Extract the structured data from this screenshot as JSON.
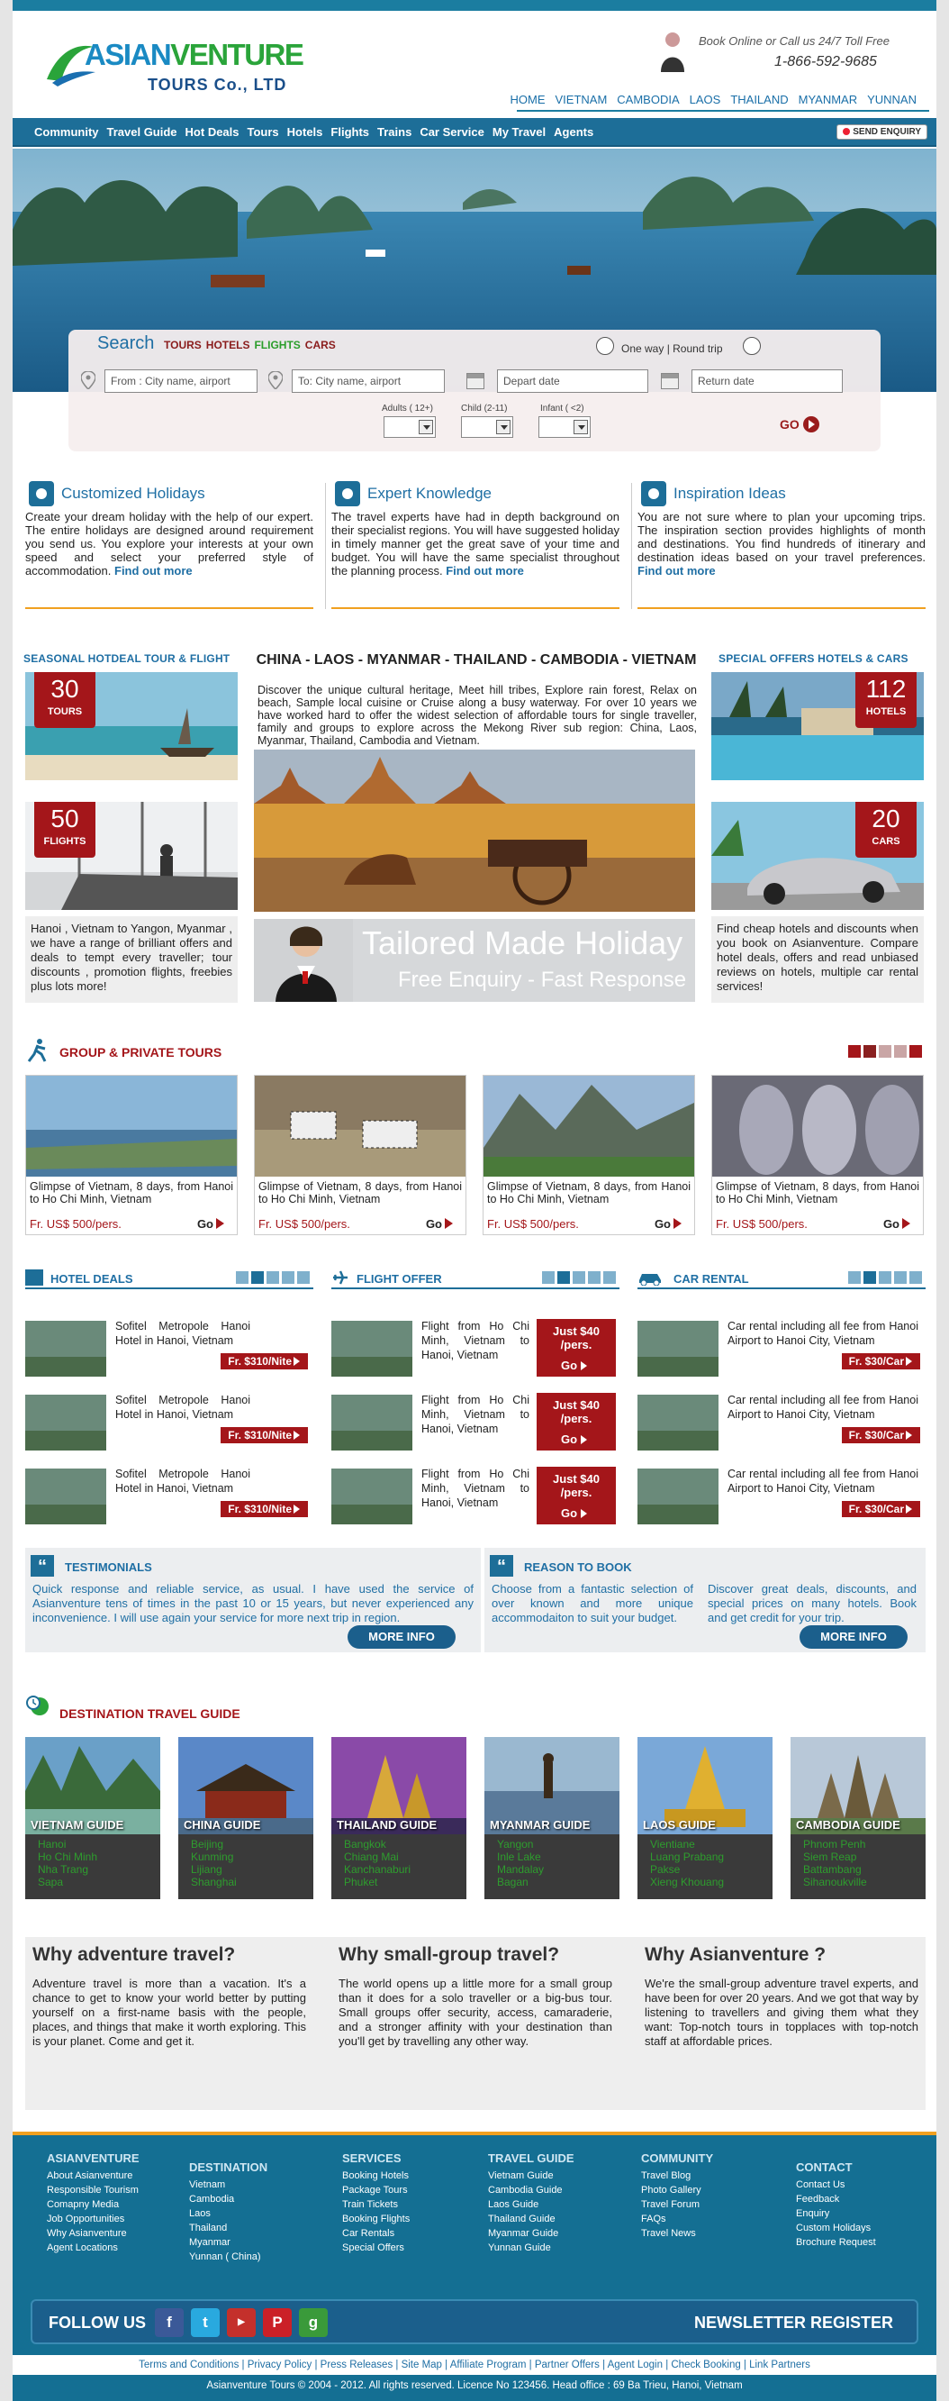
{
  "brand": {
    "logo_a": "ASIAN",
    "logo_b": "VENTURE",
    "logo_sub": "TOURS Co., LTD"
  },
  "contact": {
    "line1": "Book Online or Call us 24/7 Toll Free",
    "phone": "1-866-592-9685"
  },
  "top_nav": [
    "HOME",
    "VIETNAM",
    "CAMBODIA",
    "LAOS",
    "THAILAND",
    "MYANMAR",
    "YUNNAN"
  ],
  "main_nav": [
    "Community",
    "Travel Guide",
    "Hot Deals",
    "Tours",
    "Hotels",
    "Flights",
    "Trains",
    "Car Service",
    "My Travel",
    "Agents"
  ],
  "send_enquiry": "SEND ENQUIRY",
  "search": {
    "label": "Search",
    "tabs": [
      "TOURS",
      "HOTELS",
      "FLIGHTS",
      "CARS"
    ],
    "trip_label": "One way  |  Round trip",
    "from_placeholder": "From : City name, airport",
    "to_placeholder": "To: City name, airport",
    "depart_placeholder": "Depart date",
    "return_placeholder": "Return  date",
    "adults_label": "Adults ( 12+)",
    "child_label": "Child (2-11)",
    "infant_label": "Infant ( <2)",
    "go": "GO"
  },
  "features": [
    {
      "title": "Customized Holidays",
      "text": "Create your dream holiday with the help of our expert. The entire holidays are designed around requirement you send us.  You  explore your interests at your own speed and select your preferred style of accommodation. ",
      "more": "Find out more"
    },
    {
      "title": "Expert Knowledge",
      "text": "The travel experts have had in  depth background on their specialist regions. You will have suggested holiday in timely manner get the great save of your time and budget. You will have the same  specialist throughout the planning process. ",
      "more": "Find out more"
    },
    {
      "title": "Inspiration Ideas",
      "text": "You are not sure where to plan your upcoming trips. The inspiration section provides highlights of month and destinations. You find hundreds of itinerary and destination ideas based on your travel preferences. ",
      "more": "Find out more"
    }
  ],
  "left_promos": {
    "heading": "SEASONAL  HOTDEAL TOUR  &  FLIGHT",
    "tours_num": "30",
    "tours_label": "TOURS",
    "flights_num": "50",
    "flights_label": "FLIGHTS",
    "text": "Hanoi , Vietnam to Yangon, Myanmar , we have a range of brilliant offers and deals to tempt every traveller; tour discounts , promotion flights, freebies plus lots more!"
  },
  "center": {
    "title": "CHINA - LAOS - MYANMAR  - THAILAND - CAMBODIA - VIETNAM",
    "text": "Discover the unique cultural heritage, Meet hill tribes, Explore rain forest, Relax on beach, Sample local cuisine or Cruise along a busy waterway. For over 10 years we have worked hard to offer the widest selection of affordable tours for single traveller, family and groups to explore across the Mekong River sub region: China, Laos, Myanmar, Thailand, Cambodia and Vietnam.",
    "tailor_title": "Tailored Made Holiday",
    "tailor_sub": "Free Enquiry - Fast Response"
  },
  "right_promos": {
    "heading": "SPECIAL  OFFERS  HOTELS  &  CARS",
    "hotels_num": "112",
    "hotels_label": "HOTELS",
    "cars_num": "20",
    "cars_label": "CARS",
    "text": "Find cheap hotels and discounts when you book on Asianventure. Compare hotel deals, offers and read unbiased reviews on hotels, multiple car rental services!"
  },
  "group_tours": {
    "heading": "GROUP & PRIVATE TOURS",
    "items": [
      {
        "caption": "Glimpse of Vietnam, 8 days, from Hanoi to Ho Chi Minh, Vietnam",
        "price": "Fr. US$ 500/pers.",
        "go": "Go"
      },
      {
        "caption": "Glimpse of Vietnam, 8 days, from Hanoi to Ho Chi Minh, Vietnam",
        "price": "Fr. US$ 500/pers.",
        "go": "Go"
      },
      {
        "caption": "Glimpse of Vietnam, 8 days, from Hanoi to Ho Chi Minh, Vietnam",
        "price": "Fr. US$ 500/pers.",
        "go": "Go"
      },
      {
        "caption": "Glimpse of Vietnam, 8 days, from Hanoi to Ho Chi Minh, Vietnam",
        "price": "Fr. US$ 500/pers.",
        "go": "Go"
      }
    ]
  },
  "hotel_deals": {
    "heading": "HOTEL DEALS",
    "items": [
      {
        "text": "Sofitel  Metropole  Hanoi  Hotel in Hanoi, Vietnam",
        "price": "Fr. $310/Nite"
      },
      {
        "text": "Sofitel  Metropole  Hanoi  Hotel in Hanoi, Vietnam",
        "price": "Fr. $310/Nite"
      },
      {
        "text": "Sofitel  Metropole  Hanoi  Hotel in Hanoi, Vietnam",
        "price": "Fr. $310/Nite"
      }
    ]
  },
  "flight_offer": {
    "heading": "FLIGHT OFFER",
    "items": [
      {
        "text": "Flight from Ho Chi Minh,  Vietnam  to Hanoi, Vietnam",
        "price": "Just $40 /pers.",
        "go": "Go"
      },
      {
        "text": "Flight from Ho Chi Minh,  Vietnam  to Hanoi, Vietnam",
        "price": "Just $40 /pers.",
        "go": "Go"
      },
      {
        "text": "Flight from Ho Chi Minh,  Vietnam  to Hanoi, Vietnam",
        "price": "Just $40 /pers.",
        "go": "Go"
      }
    ]
  },
  "car_rental": {
    "heading": "CAR RENTAL",
    "items": [
      {
        "text": "Car rental including all fee from Hanoi Airport to Hanoi City, Vietnam",
        "price": "Fr. $30/Car"
      },
      {
        "text": "Car rental including all fee from Hanoi Airport to Hanoi City, Vietnam",
        "price": "Fr. $30/Car"
      },
      {
        "text": "Car rental including all fee from Hanoi Airport to Hanoi City, Vietnam",
        "price": "Fr. $30/Car"
      }
    ]
  },
  "testimonials": {
    "heading": "TESTIMONIALS",
    "text": "Quick response and reliable service, as usual. I have used the service of Asianventure tens of times in the past 10 or 15 years, but never experienced any inconvenience.  I will use again your service for more next trip in region.",
    "button": "MORE INFO"
  },
  "reason": {
    "heading": "REASON TO BOOK",
    "text1": "Choose from a fantastic selection of over  known  and  more  unique accommodaiton  to suit your budget.",
    "text2": "Discover great deals, discounts, and special prices on many hotels.  Book and get credit for your trip.",
    "button": "MORE INFO"
  },
  "guides": {
    "heading": "DESTINATION TRAVEL GUIDE",
    "items": [
      {
        "name": "VIETNAM GUIDE",
        "cities": [
          "Hanoi",
          "Ho Chi Minh",
          "Nha Trang",
          "Sapa"
        ]
      },
      {
        "name": "CHINA GUIDE",
        "cities": [
          "Beijing",
          "Kunming",
          "Lijiang",
          "Shanghai"
        ]
      },
      {
        "name": "THAILAND GUIDE",
        "cities": [
          "Bangkok",
          "Chiang Mai",
          "Kanchanaburi",
          "Phuket"
        ]
      },
      {
        "name": "MYANMAR GUIDE",
        "cities": [
          "Yangon",
          "Inle Lake",
          "Mandalay",
          "Bagan"
        ]
      },
      {
        "name": "LAOS GUIDE",
        "cities": [
          "Vientiane",
          "Luang Prabang",
          "Pakse",
          "Xieng Khouang"
        ]
      },
      {
        "name": "CAMBODIA GUIDE",
        "cities": [
          "Phnom Penh",
          "Siem Reap",
          "Battambang",
          "Sihanoukville"
        ]
      }
    ]
  },
  "why": [
    {
      "title": "Why adventure travel?",
      "text": "Adventure travel is more than a vacation. It's a chance to get to know your world better by putting yourself on a first-name basis with the people, places, and things that make it worth exploring. This is your planet. Come and get it."
    },
    {
      "title": "Why small-group travel?",
      "text": "The world opens up a little more for a small group than it does for a solo traveller or a big-bus tour. Small groups offer security, access, camaraderie, and a stronger affinity with your destination than you'll get by travelling any other way."
    },
    {
      "title": "Why Asianventure ?",
      "text": "We're the small-group adventure travel experts, and have been for over 20 years. And we got that way by listening to travellers and giving them what they want: Top-notch tours in topplaces with top-notch staff at affordable prices."
    }
  ],
  "footer": {
    "cols": [
      {
        "title": "ASIANVENTURE",
        "links": [
          "About Asianventure",
          "Responsible Tourism",
          "Comapny Media",
          "Job Opportunities",
          "Why Asianventure",
          "Agent Locations"
        ]
      },
      {
        "title": "DESTINATION",
        "links": [
          "Vietnam",
          "Cambodia",
          "Laos",
          "Thailand",
          "Myanmar",
          "Yunnan ( China)"
        ]
      },
      {
        "title": "SERVICES",
        "links": [
          "Booking Hotels",
          "Package Tours",
          "Train Tickets",
          "Booking Flights",
          "Car Rentals",
          "Special Offers"
        ]
      },
      {
        "title": "TRAVEL GUIDE",
        "links": [
          "Vietnam Guide",
          "Cambodia Guide",
          "Laos Guide",
          "Thailand Guide",
          "Myanmar Guide",
          "Yunnan Guide"
        ]
      },
      {
        "title": "COMMUNITY",
        "links": [
          "Travel Blog",
          "Photo Gallery",
          "Travel Forum",
          "FAQs",
          "Travel News"
        ]
      },
      {
        "title": "CONTACT",
        "links": [
          "Contact Us",
          "Feedback",
          "Enquiry",
          "Custom Holidays",
          "Brochure Request"
        ]
      }
    ],
    "follow": "FOLLOW US",
    "newsletter": "NEWSLETTER REGISTER",
    "links": "Terms  and Conditions | Privacy Policy |  Press Releases | Site Map |  Affiliate Program  | Partner Offers  | Agent Login | Check Booking  | Link Partners",
    "copyright": "Asianventure Tours © 2004 - 2012. All rights reserved. Licence No   123456. Head office : 69 Ba Trieu, Hanoi, Vietnam"
  }
}
